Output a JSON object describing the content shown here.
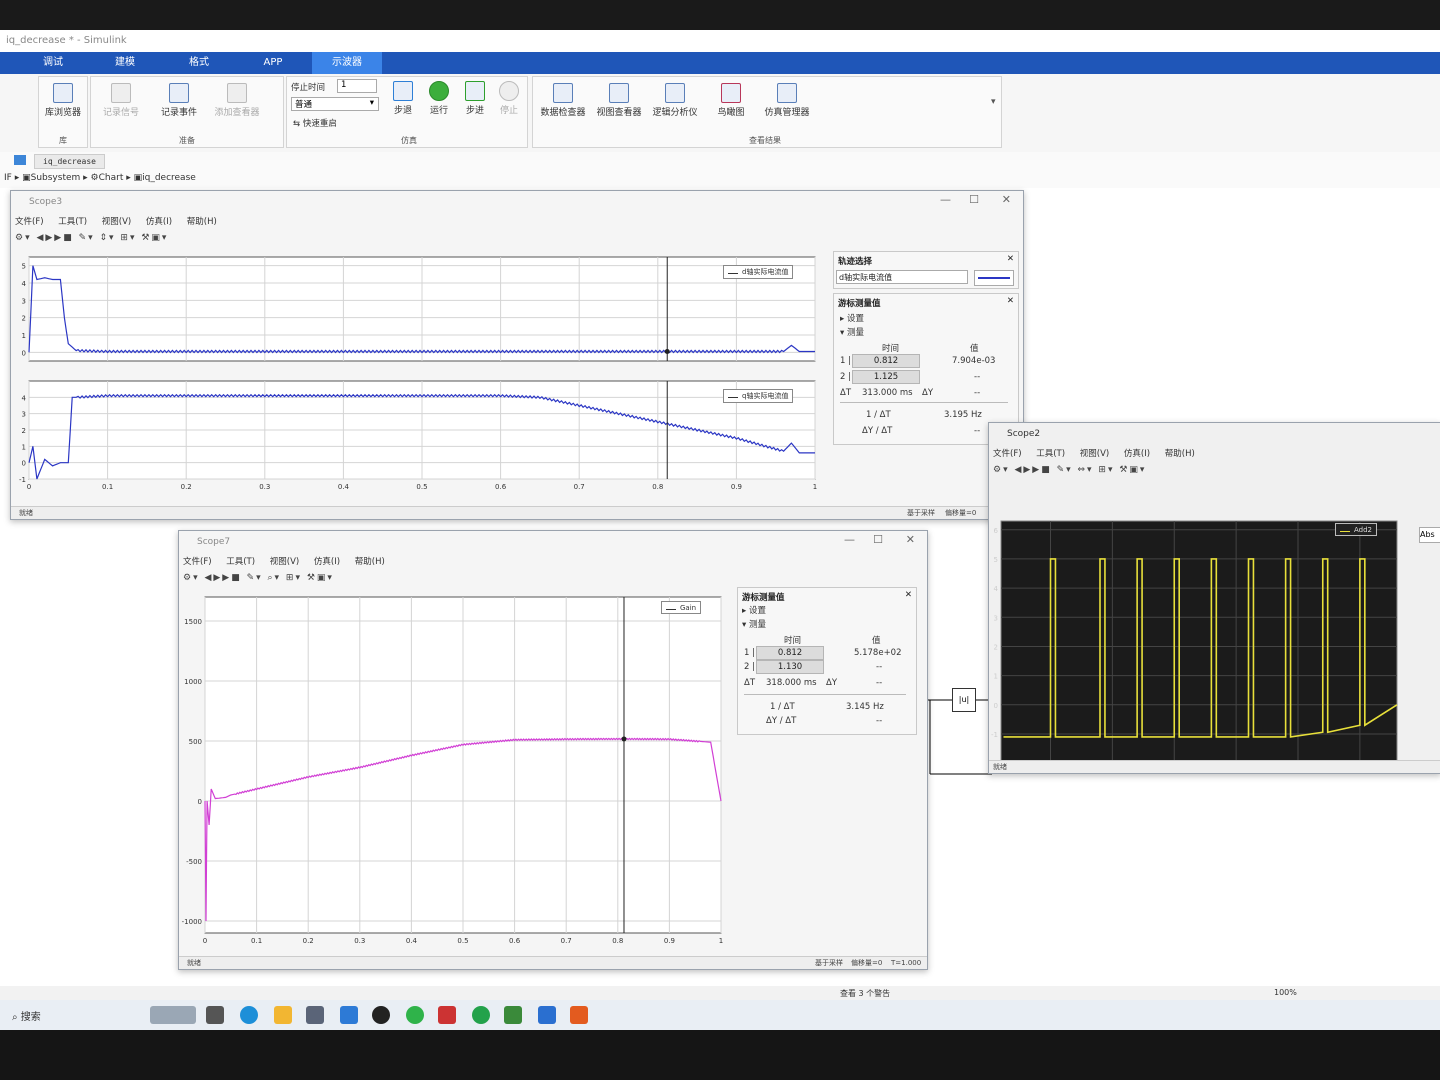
{
  "window": {
    "title": "iq_decrease * - Simulink"
  },
  "tabs": [
    {
      "label": "调试",
      "active": false
    },
    {
      "label": "建模",
      "active": false
    },
    {
      "label": "格式",
      "active": false
    },
    {
      "label": "APP",
      "active": false
    },
    {
      "label": "示波器",
      "active": true
    }
  ],
  "ribbon": {
    "library_browser": "库浏览器",
    "record_signal": "记录信号",
    "record_event": "记录事件",
    "add_viewer": "添加查看器",
    "stop_time_label": "停止时间",
    "stop_time_value": "1",
    "mode_value": "普通",
    "fast_restart": "快速重启",
    "step_back": "步退",
    "run": "运行",
    "step": "步进",
    "stop": "停止",
    "data_inspector": "数据检查器",
    "view_viewer": "视图查看器",
    "logic_analyzer": "逻辑分析仪",
    "birds_eye": "鸟瞰图",
    "sim_manager": "仿真管理器",
    "group_library": "库",
    "group_prepare": "准备",
    "group_sim": "仿真",
    "group_results": "查看结果"
  },
  "breadcrumb": {
    "tab": "iq_decrease",
    "path": [
      "IF",
      "Subsystem",
      "Chart",
      "iq_decrease"
    ]
  },
  "menus": [
    "文件(F)",
    "工具(T)",
    "视图(V)",
    "仿真(I)",
    "帮助(H)"
  ],
  "scope3": {
    "title": "Scope3",
    "status": "就绪",
    "status_right": [
      "基于采样",
      "偏移量=0"
    ],
    "legend1": "d轴实际电流值",
    "legend2": "q轴实际电流值",
    "trace_panel": {
      "title": "轨迹选择",
      "selected": "d轴实际电流值"
    },
    "cursor_panel": {
      "title": "游标测量值",
      "settings": "设置",
      "measure": "测量",
      "col_time": "时间",
      "col_value": "值",
      "t1": "0.812",
      "v1": "7.904e-03",
      "t2": "1.125",
      "v2": "--",
      "dt": "313.000 ms",
      "dy": "--",
      "inv_dt": "3.195 Hz",
      "dydt": "--"
    }
  },
  "scope7": {
    "title": "Scope7",
    "status": "就绪",
    "status_right": [
      "基于采样",
      "偏移量=0",
      "T=1.000"
    ],
    "legend": "Gain",
    "cursor_panel": {
      "title": "游标测量值",
      "settings": "设置",
      "measure": "测量",
      "col_time": "时间",
      "col_value": "值",
      "t1": "0.812",
      "v1": "5.178e+02",
      "t2": "1.130",
      "v2": "--",
      "dt": "318.000 ms",
      "dy": "--",
      "inv_dt": "3.145 Hz",
      "dydt": "--"
    }
  },
  "scope2": {
    "title": "Scope2",
    "status": "就绪",
    "legend": "Add2",
    "side_label": "Abs"
  },
  "labels": {
    "dt": "ΔT",
    "dy": "ΔY",
    "inv_dt": "1 / ΔT",
    "dydt": "ΔY / ΔT",
    "row1": "1 |",
    "row2": "2 |"
  },
  "status": {
    "warnings": "查看 3 个警告",
    "zoom": "100%"
  },
  "abs_block": "|u|",
  "taskbar": {
    "search": "搜索"
  },
  "colors": {
    "d_axis": "#2b36c4",
    "q_axis": "#2b36c4",
    "gain": "#d13fd4",
    "scope2_line": "#e8e03a",
    "ribbon_tab": "#1f56b8"
  },
  "chart_data": [
    {
      "type": "line",
      "name": "Scope3 top (d-axis current)",
      "x": [
        0,
        0.005,
        0.01,
        0.02,
        0.03,
        0.04,
        0.045,
        0.05,
        0.06,
        0.1,
        0.2,
        0.3,
        0.4,
        0.5,
        0.6,
        0.7,
        0.8,
        0.9,
        0.96,
        0.97,
        0.98,
        1.0
      ],
      "y": [
        0,
        5,
        4.2,
        4.3,
        4.2,
        4.2,
        2.0,
        0.5,
        0.1,
        0.05,
        0.05,
        0.05,
        0.05,
        0.05,
        0.05,
        0.05,
        0.05,
        0.05,
        0.05,
        0.4,
        0.05,
        0.05
      ],
      "xlim": [
        0,
        1
      ],
      "ylim": [
        -0.5,
        5.5
      ],
      "xticks": [
        "0",
        "0.1",
        "0.2",
        "0.3",
        "0.4",
        "0.5",
        "0.6",
        "0.7",
        "0.8",
        "0.9",
        "1"
      ],
      "yticks": [
        "0",
        "1",
        "2",
        "3",
        "4",
        "5"
      ]
    },
    {
      "type": "line",
      "name": "Scope3 bottom (q-axis current)",
      "x": [
        0,
        0.005,
        0.01,
        0.02,
        0.03,
        0.04,
        0.05,
        0.055,
        0.06,
        0.1,
        0.2,
        0.3,
        0.4,
        0.5,
        0.6,
        0.65,
        0.7,
        0.8,
        0.9,
        0.96,
        0.97,
        0.98,
        1.0
      ],
      "y": [
        0,
        1,
        -1,
        0.2,
        -0.2,
        0,
        0,
        4.0,
        4.0,
        4.1,
        4.1,
        4.1,
        4.1,
        4.1,
        4.1,
        4.0,
        3.5,
        2.5,
        1.5,
        0.7,
        1.2,
        0.6,
        0.6
      ],
      "xlim": [
        0,
        1
      ],
      "ylim": [
        -1,
        5
      ],
      "xticks": [
        "0",
        "0.1",
        "0.2",
        "0.3",
        "0.4",
        "0.5",
        "0.6",
        "0.7",
        "0.8",
        "0.9",
        "1"
      ],
      "yticks": [
        "-1",
        "0",
        "1",
        "2",
        "3",
        "4"
      ]
    },
    {
      "type": "line",
      "name": "Scope7 (Gain)",
      "x": [
        0,
        0.002,
        0.004,
        0.008,
        0.012,
        0.02,
        0.04,
        0.05,
        0.1,
        0.2,
        0.3,
        0.4,
        0.5,
        0.6,
        0.7,
        0.8,
        0.9,
        0.98,
        1.0
      ],
      "y": [
        0,
        -1000,
        0,
        -200,
        100,
        20,
        30,
        50,
        100,
        200,
        280,
        380,
        470,
        510,
        515,
        517,
        515,
        490,
        0
      ],
      "xlim": [
        0,
        1
      ],
      "ylim": [
        -1100,
        1700
      ],
      "xticks": [
        "0",
        "0.1",
        "0.2",
        "0.3",
        "0.4",
        "0.5",
        "0.6",
        "0.7",
        "0.8",
        "0.9",
        "1"
      ],
      "yticks": [
        "-1000",
        "-500",
        "0",
        "500",
        "1000",
        "1500"
      ]
    },
    {
      "type": "line",
      "name": "Scope2 (Add2)",
      "pulses_x": [
        0.7,
        0.74,
        0.77,
        0.8,
        0.83,
        0.86,
        0.89,
        0.92,
        0.95
      ],
      "low": -1.1,
      "high": 5,
      "xlim": [
        0.66,
        0.98
      ],
      "ylim": [
        -2.2,
        6.3
      ],
      "xticks": [
        "0.7",
        "0.75",
        "0.8",
        "0.85",
        "0.9",
        "0.95"
      ],
      "yticks": [
        "-2",
        "-1",
        "0",
        "1",
        "2",
        "3",
        "4",
        "5",
        "6"
      ]
    }
  ]
}
